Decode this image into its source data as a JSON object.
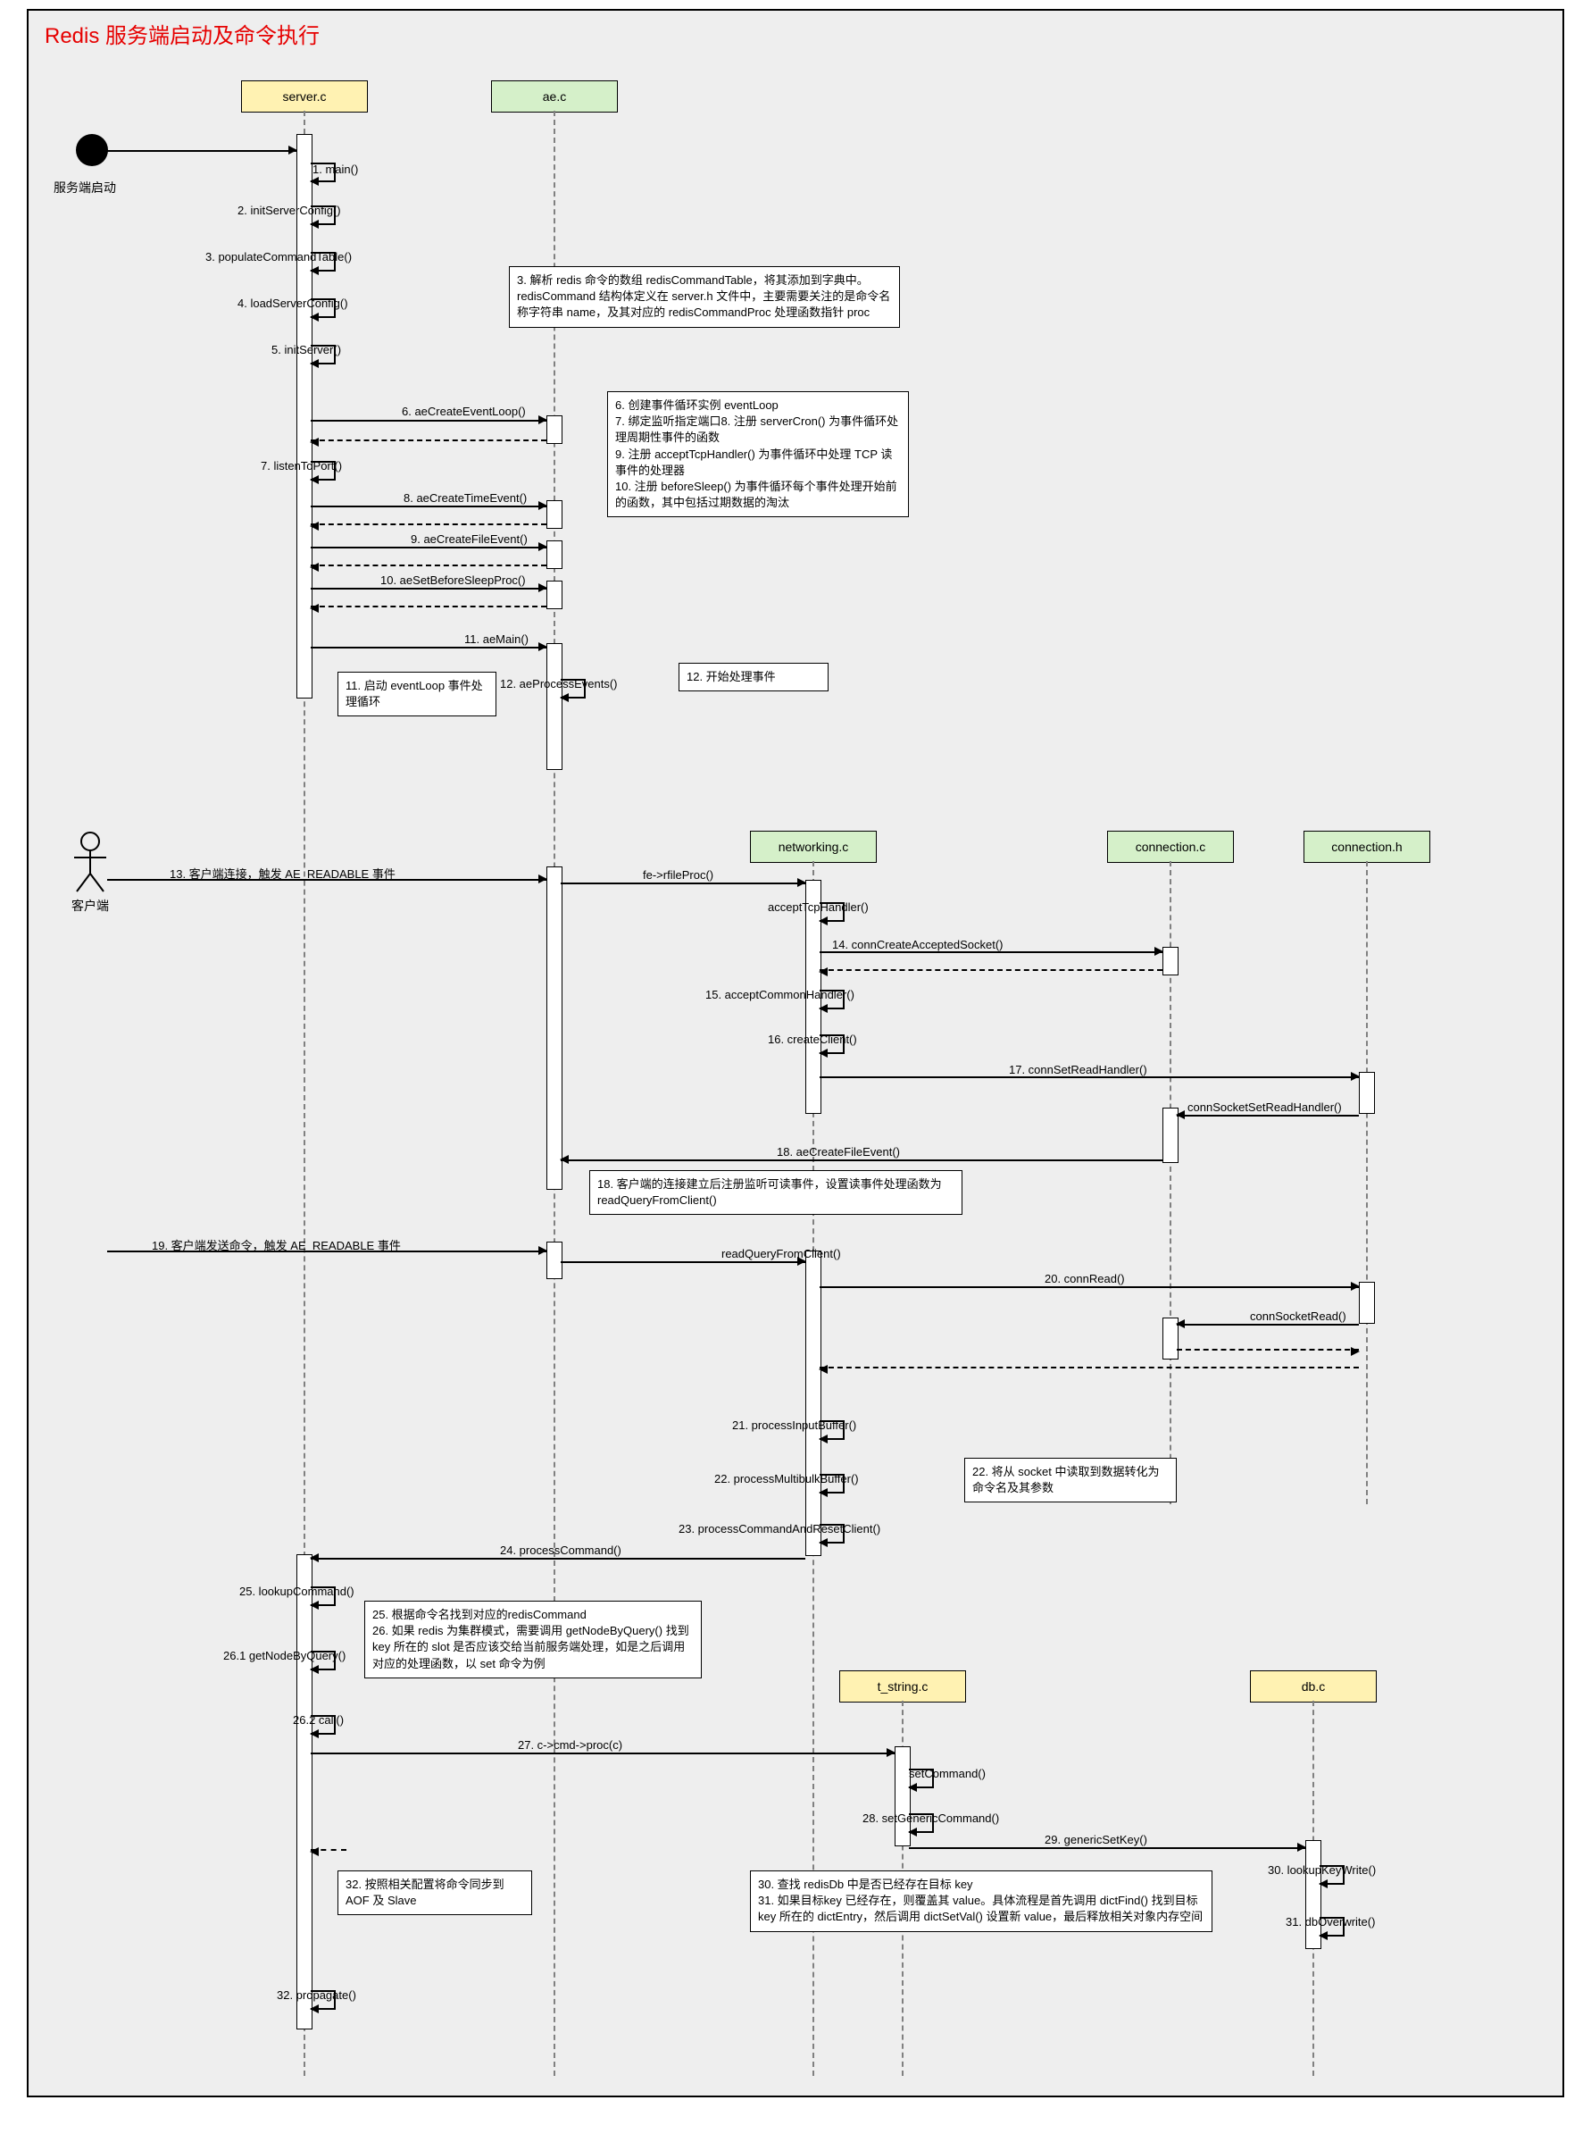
{
  "title": "Redis 服务端启动及命令执行",
  "start_label": "服务端启动",
  "actor_label": "客户端",
  "lifelines": {
    "server": "server.c",
    "ae": "ae.c",
    "networking": "networking.c",
    "conn_c": "connection.c",
    "conn_h": "connection.h",
    "tstring": "t_string.c",
    "db": "db.c"
  },
  "msgs": {
    "m1": "1. main()",
    "m2": "2. initServerConfig()",
    "m3": "3. populateCommandTable()",
    "m4": "4. loadServerConfig()",
    "m5": "5. initServer()",
    "m6": "6. aeCreateEventLoop()",
    "m7": "7. listenToPort()",
    "m8": "8. aeCreateTimeEvent()",
    "m9": "9. aeCreateFileEvent()",
    "m10": "10. aeSetBeforeSleepProc()",
    "m11": "11. aeMain()",
    "m12": "12. aeProcessEvents()",
    "m13": "13. 客户端连接，触发 AE_READABLE 事件",
    "m_fe": "fe->rfileProc()",
    "m_accept": "acceptTcpHandler()",
    "m14": "14. connCreateAcceptedSocket()",
    "m15": "15. acceptCommonHandler()",
    "m16": "16. createClient()",
    "m17": "17. connSetReadHandler()",
    "m_connSock": "connSocketSetReadHandler()",
    "m18": "18. aeCreateFileEvent()",
    "m19": "19. 客户端发送命令，触发 AE_READABLE 事件",
    "m_readQ": "readQueryFromClient()",
    "m20": "20. connRead()",
    "m_connRead": "connSocketRead()",
    "m21": "21. processInputBuffer()",
    "m22": "22. processMultibulkBuffer()",
    "m23": "23. processCommandAndResetClient()",
    "m24": "24. processCommand()",
    "m25": "25. lookupCommand()",
    "m26_1": "26.1 getNodeByQuery()",
    "m26_2": "26.2 call()",
    "m27": "27. c->cmd->proc(c)",
    "m_setCmd": "setCommand()",
    "m28": "28. setGenericCommand()",
    "m29": "29. genericSetKey()",
    "m30": "30. lookupKeyWrite()",
    "m31": "31. dbOverwrite()",
    "m32": "32. propagate()"
  },
  "notes": {
    "n3": "3. 解析 redis 命令的数组 redisCommandTable，将其添加到字典中。redisCommand 结构体定义在 server.h 文件中，主要需要关注的是命令名称字符串 name，及其对应的 redisCommandProc 处理函数指针 proc",
    "n6": "6. 创建事件循环实例 eventLoop\n7. 绑定监听指定端口8. 注册 serverCron() 为事件循环处理周期性事件的函数\n9. 注册 acceptTcpHandler() 为事件循环中处理 TCP 读事件的处理器\n10. 注册 beforeSleep() 为事件循环每个事件处理开始前的函数，其中包括过期数据的淘汰",
    "n11": "11. 启动 eventLoop 事件处理循环",
    "n12": "12. 开始处理事件",
    "n18": "18. 客户端的连接建立后注册监听可读事件，设置读事件处理函数为 readQueryFromClient()",
    "n22": "22. 将从 socket 中读取到数据转化为命令名及其参数",
    "n25": "25. 根据命令名找到对应的redisCommand\n26. 如果 redis 为集群模式，需要调用 getNodeByQuery() 找到 key 所在的 slot 是否应该交给当前服务端处理，如是之后调用对应的处理函数，以 set 命令为例",
    "n30": "30. 查找 redisDb 中是否已经存在目标 key\n31. 如果目标key 已经存在，则覆盖其 value。具体流程是首先调用 dictFind() 找到目标key 所在的 dictEntry，然后调用 dictSetVal() 设置新 value，最后释放相关对象内存空间",
    "n32": "32. 按照相关配置将命令同步到 AOF 及 Slave"
  },
  "chart_data": {
    "type": "sequence_diagram",
    "title": "Redis 服务端启动及命令执行",
    "participants": [
      "服务端启动(start)",
      "客户端(actor)",
      "server.c",
      "ae.c",
      "networking.c",
      "connection.c",
      "connection.h",
      "t_string.c",
      "db.c"
    ],
    "messages": [
      {
        "n": 1,
        "from": "start",
        "to": "server.c",
        "label": "main()"
      },
      {
        "n": 2,
        "from": "server.c",
        "to": "server.c",
        "label": "initServerConfig()"
      },
      {
        "n": 3,
        "from": "server.c",
        "to": "server.c",
        "label": "populateCommandTable()",
        "note": "解析 redis 命令的数组 redisCommandTable，将其添加到字典中"
      },
      {
        "n": 4,
        "from": "server.c",
        "to": "server.c",
        "label": "loadServerConfig()"
      },
      {
        "n": 5,
        "from": "server.c",
        "to": "server.c",
        "label": "initServer()"
      },
      {
        "n": 6,
        "from": "server.c",
        "to": "ae.c",
        "label": "aeCreateEventLoop()",
        "note": "创建事件循环实例 eventLoop"
      },
      {
        "n": 7,
        "from": "server.c",
        "to": "server.c",
        "label": "listenToPort()",
        "note": "绑定监听指定端口"
      },
      {
        "n": 8,
        "from": "server.c",
        "to": "ae.c",
        "label": "aeCreateTimeEvent()",
        "note": "注册 serverCron() 为事件循环处理周期性事件的函数"
      },
      {
        "n": 9,
        "from": "server.c",
        "to": "ae.c",
        "label": "aeCreateFileEvent()",
        "note": "注册 acceptTcpHandler() 为事件循环中处理 TCP 读事件的处理器"
      },
      {
        "n": 10,
        "from": "server.c",
        "to": "ae.c",
        "label": "aeSetBeforeSleepProc()",
        "note": "注册 beforeSleep() 为事件循环每个事件处理开始前的函数"
      },
      {
        "n": 11,
        "from": "server.c",
        "to": "ae.c",
        "label": "aeMain()",
        "note": "启动 eventLoop 事件处理循环"
      },
      {
        "n": 12,
        "from": "ae.c",
        "to": "ae.c",
        "label": "aeProcessEvents()",
        "note": "开始处理事件"
      },
      {
        "n": 13,
        "from": "客户端",
        "to": "ae.c",
        "label": "客户端连接，触发 AE_READABLE 事件"
      },
      {
        "n": 0,
        "from": "ae.c",
        "to": "networking.c",
        "label": "fe->rfileProc()"
      },
      {
        "n": 0,
        "from": "networking.c",
        "to": "networking.c",
        "label": "acceptTcpHandler()"
      },
      {
        "n": 14,
        "from": "networking.c",
        "to": "connection.c",
        "label": "connCreateAcceptedSocket()"
      },
      {
        "n": 15,
        "from": "networking.c",
        "to": "networking.c",
        "label": "acceptCommonHandler()"
      },
      {
        "n": 16,
        "from": "networking.c",
        "to": "networking.c",
        "label": "createClient()"
      },
      {
        "n": 17,
        "from": "networking.c",
        "to": "connection.h",
        "label": "connSetReadHandler()"
      },
      {
        "n": 0,
        "from": "connection.h",
        "to": "connection.c",
        "label": "connSocketSetReadHandler()"
      },
      {
        "n": 18,
        "from": "connection.c",
        "to": "ae.c",
        "label": "aeCreateFileEvent()",
        "note": "客户端的连接建立后注册监听可读事件，设置读事件处理函数为 readQueryFromClient()"
      },
      {
        "n": 19,
        "from": "客户端",
        "to": "ae.c",
        "label": "客户端发送命令，触发 AE_READABLE 事件"
      },
      {
        "n": 0,
        "from": "ae.c",
        "to": "networking.c",
        "label": "readQueryFromClient()"
      },
      {
        "n": 20,
        "from": "networking.c",
        "to": "connection.h",
        "label": "connRead()"
      },
      {
        "n": 0,
        "from": "connection.h",
        "to": "connection.c",
        "label": "connSocketRead()"
      },
      {
        "n": 21,
        "from": "networking.c",
        "to": "networking.c",
        "label": "processInputBuffer()"
      },
      {
        "n": 22,
        "from": "networking.c",
        "to": "networking.c",
        "label": "processMultibulkBuffer()",
        "note": "将从 socket 中读取到数据转化为命令名及其参数"
      },
      {
        "n": 23,
        "from": "networking.c",
        "to": "networking.c",
        "label": "processCommandAndResetClient()"
      },
      {
        "n": 24,
        "from": "networking.c",
        "to": "server.c",
        "label": "processCommand()"
      },
      {
        "n": 25,
        "from": "server.c",
        "to": "server.c",
        "label": "lookupCommand()",
        "note": "根据命令名找到对应的redisCommand"
      },
      {
        "n": 26.1,
        "from": "server.c",
        "to": "server.c",
        "label": "getNodeByQuery()",
        "note": "如果 redis 为集群模式，需要调用 getNodeByQuery() 找到 key 所在的 slot"
      },
      {
        "n": 26.2,
        "from": "server.c",
        "to": "server.c",
        "label": "call()"
      },
      {
        "n": 27,
        "from": "server.c",
        "to": "t_string.c",
        "label": "c->cmd->proc(c)"
      },
      {
        "n": 0,
        "from": "t_string.c",
        "to": "t_string.c",
        "label": "setCommand()"
      },
      {
        "n": 28,
        "from": "t_string.c",
        "to": "t_string.c",
        "label": "setGenericCommand()"
      },
      {
        "n": 29,
        "from": "t_string.c",
        "to": "db.c",
        "label": "genericSetKey()"
      },
      {
        "n": 30,
        "from": "db.c",
        "to": "db.c",
        "label": "lookupKeyWrite()",
        "note": "查找 redisDb 中是否已经存在目标 key"
      },
      {
        "n": 31,
        "from": "db.c",
        "to": "db.c",
        "label": "dbOverwrite()",
        "note": "如果目标key 已经存在，则覆盖其 value"
      },
      {
        "n": 32,
        "from": "server.c",
        "to": "server.c",
        "label": "propagate()",
        "note": "按照相关配置将命令同步到 AOF 及 Slave"
      }
    ]
  }
}
